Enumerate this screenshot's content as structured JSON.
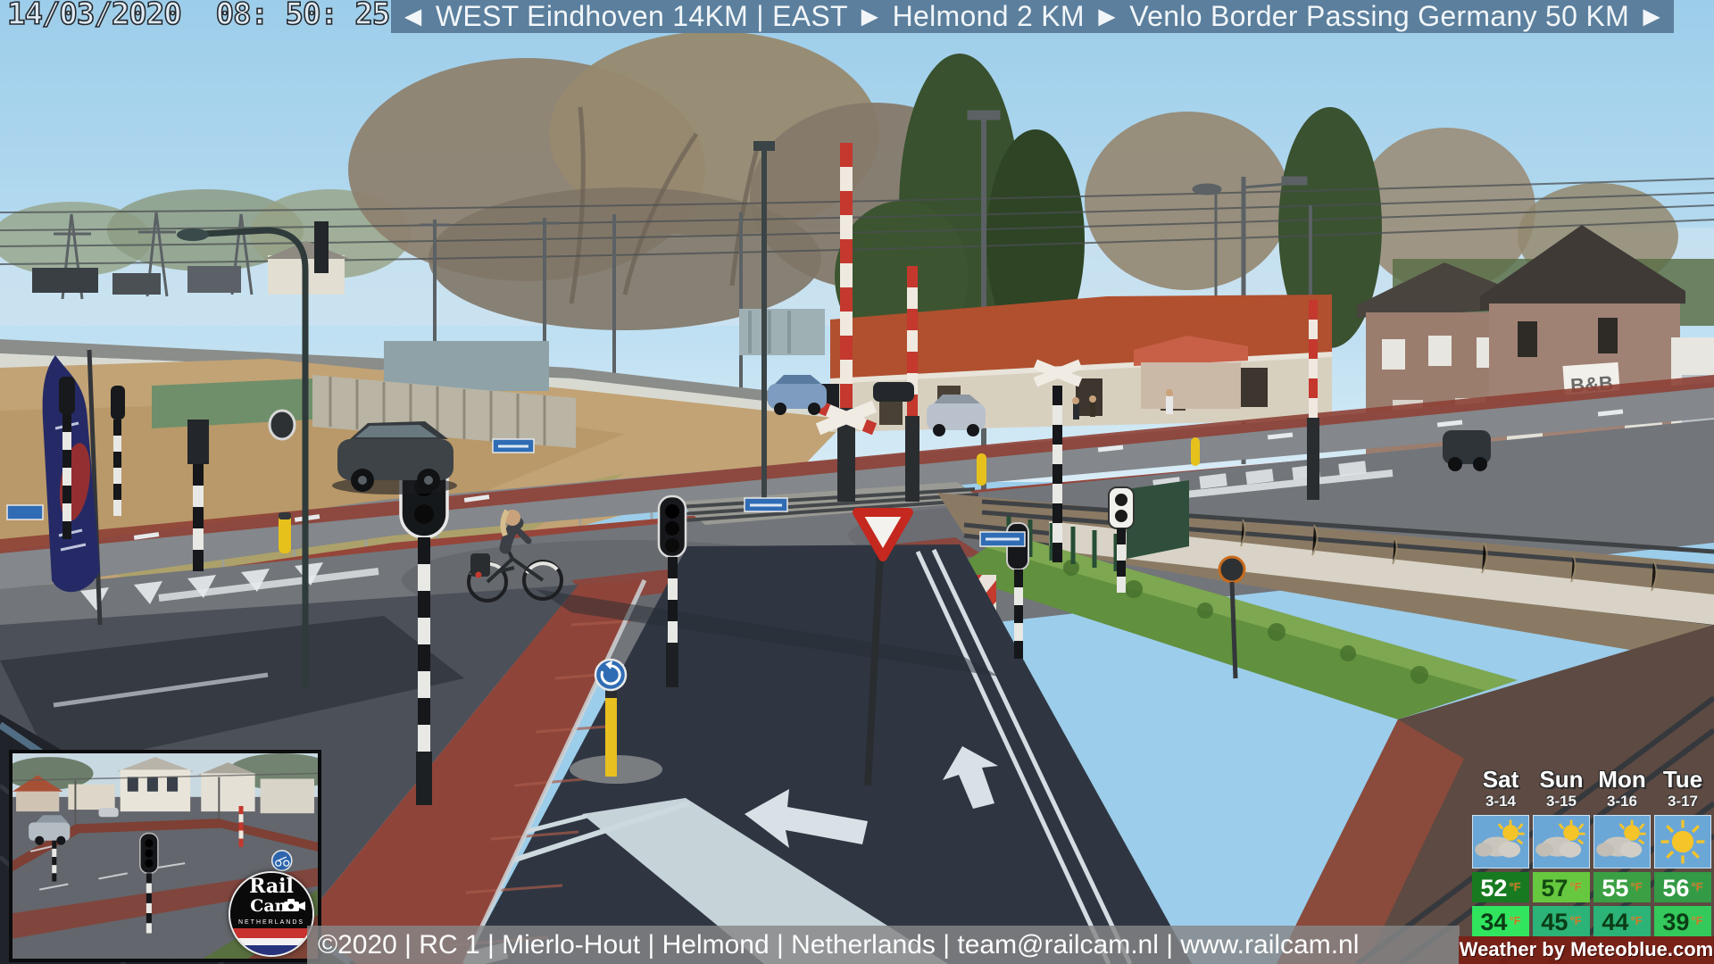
{
  "overlay": {
    "timestamp": "14/03/2020  08: 50: 25",
    "direction_banner": "◄ WEST Eindhoven 14KM | EAST ► Helmond 2 KM ► Venlo  Border Passing Germany 50 KM ►",
    "info_bar": "©2020 |  RC 1 | Mierlo-Hout | Helmond | Netherlands | team@railcam.nl | www.railcam.nl"
  },
  "weather": {
    "days": [
      "Sat",
      "Sun",
      "Mon",
      "Tue"
    ],
    "dates": [
      "3-14",
      "3-15",
      "3-16",
      "3-17"
    ],
    "icons": [
      "sun-behind-cloud",
      "sun-behind-cloud",
      "sun-behind-cloud",
      "sunny"
    ],
    "highs": [
      "52",
      "57",
      "55",
      "56"
    ],
    "lows": [
      "34",
      "45",
      "44",
      "39"
    ],
    "unit": "°F",
    "credit": "Weather by Meteoblue.com",
    "colors": {
      "tile": "#6ba7d6",
      "high_bg": [
        "#187a20",
        "#66c83e",
        "#3aa043",
        "#339a45"
      ],
      "high_fg": [
        "#ffffff",
        "#114a11",
        "#ffffff",
        "#ffffff"
      ],
      "low_bg": [
        "#31e55f",
        "#2cb377",
        "#2cb377",
        "#34c95b"
      ],
      "low_fg": [
        "#0b3d16",
        "#0b3d16",
        "#0b3d16",
        "#0b3d16"
      ]
    }
  },
  "logo": {
    "line1": "Rail",
    "line2": "Cam",
    "country": "NETHERLANDS",
    "flag_colors": [
      "#c8322e",
      "#f2f2f2",
      "#28337e"
    ]
  },
  "scene": {
    "b_and_b_sign": "B&B"
  }
}
